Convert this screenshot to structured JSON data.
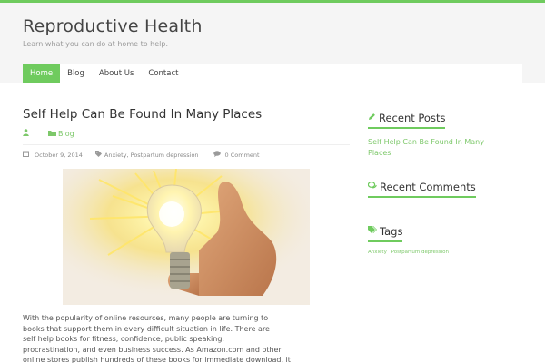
{
  "site": {
    "title": "Reproductive Health",
    "description": "Learn what you can do at home to help.",
    "accent_color": "#6fcb5e"
  },
  "nav": {
    "items": [
      {
        "label": "Home",
        "active": true
      },
      {
        "label": "Blog",
        "active": false
      },
      {
        "label": "About Us",
        "active": false
      },
      {
        "label": "Contact",
        "active": false
      }
    ]
  },
  "post": {
    "title": "Self Help Can Be Found In Many Places",
    "author_icon": "user-icon",
    "category_icon": "folder-icon",
    "category": "Blog",
    "date_icon": "calendar-icon",
    "date": "October 9, 2014",
    "tags_icon": "tag-icon",
    "tags": "Anxiety, Postpartum depression",
    "comments_icon": "comment-icon",
    "comments": "0 Comment",
    "image_subject": "hand giving thumbs up with glowing light bulb",
    "body_lines": [
      "With the popularity of online resources, many people are turning to",
      "books that support them in every difficult situation in life. There are",
      "self help books for fitness, confidence, public speaking,",
      "procrastination, and even business success. As Amazon.com and other",
      "online stores publish hundreds of these books for immediate download, it"
    ]
  },
  "sidebar": {
    "recent_posts": {
      "icon": "pencil-icon",
      "title": "Recent Posts",
      "items": [
        "Self Help Can Be Found In Many Places"
      ]
    },
    "recent_comments": {
      "icon": "comments-icon",
      "title": "Recent Comments"
    },
    "tags": {
      "icon": "tags-icon",
      "title": "Tags",
      "items": [
        "Anxiety",
        "Postpartum depression"
      ]
    }
  }
}
